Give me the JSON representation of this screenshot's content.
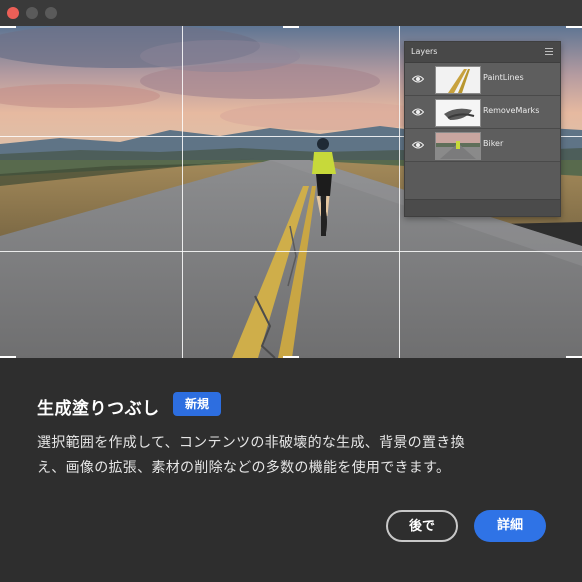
{
  "window": {
    "controls": [
      "close",
      "minimize",
      "maximize"
    ]
  },
  "layers_panel": {
    "title": "Layers",
    "menu_icon": "hamburger-menu-icon",
    "items": [
      {
        "name": "PaintLines",
        "visible_icon": "eye-icon"
      },
      {
        "name": "RemoveMarks",
        "visible_icon": "eye-icon"
      },
      {
        "name": "Biker",
        "visible_icon": "eye-icon"
      }
    ]
  },
  "feature": {
    "title": "生成塗りつぶし",
    "badge": "新規",
    "description_line1": "選択範囲を作成して、コンテンツの非破壊的な生成、背景の置き換",
    "description_line2": "え、画像の拡張、素材の削除などの多数の機能を使用できます。"
  },
  "buttons": {
    "later": "後で",
    "details": "詳細"
  },
  "colors": {
    "accent": "#2f73e6",
    "badge": "#2d6ee0",
    "background": "#2e2e2e"
  }
}
